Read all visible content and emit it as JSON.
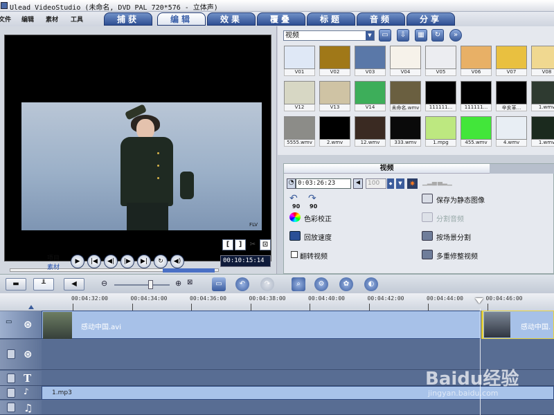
{
  "window": {
    "title": "Ulead VideoStudio (未命名, DVD PAL 720*576 - 立体声)"
  },
  "menu": {
    "items": [
      "文件",
      "编辑",
      "素材",
      "工具"
    ]
  },
  "tabs": [
    {
      "label": "捕获",
      "active": false
    },
    {
      "label": "编辑",
      "active": true
    },
    {
      "label": "效果",
      "active": false
    },
    {
      "label": "覆叠",
      "active": false
    },
    {
      "label": "标题",
      "active": false
    },
    {
      "label": "音频",
      "active": false
    },
    {
      "label": "分享",
      "active": false
    }
  ],
  "preview": {
    "project_label": "项目",
    "clip_label": "素材",
    "timecode": "00:10:15:14",
    "watermark": "FLV"
  },
  "library": {
    "dropdown_value": "视频",
    "items": [
      {
        "label": "V01",
        "color": "#dfe8f6"
      },
      {
        "label": "V02",
        "color": "#a07818"
      },
      {
        "label": "V03",
        "color": "#5a78a8"
      },
      {
        "label": "V04",
        "color": "#f6f2ea"
      },
      {
        "label": "V05",
        "color": "#ecedf1"
      },
      {
        "label": "V06",
        "color": "#e8b066"
      },
      {
        "label": "V07",
        "color": "#e9c040"
      },
      {
        "label": "V08",
        "color": "#f0d890"
      },
      {
        "label": "V12",
        "color": "#d7d7c4"
      },
      {
        "label": "V13",
        "color": "#cfc3a4"
      },
      {
        "label": "V14",
        "color": "#3dae5a"
      },
      {
        "label": "未命名.wmv",
        "color": "#6a5f40"
      },
      {
        "label": "111111...",
        "color": "#000000"
      },
      {
        "label": "111111...",
        "color": "#000000"
      },
      {
        "label": "辛亥革...",
        "color": "#000000"
      },
      {
        "label": "1.wmv",
        "color": "#2e3a30"
      },
      {
        "label": "5555.wmv",
        "color": "#8c8c88"
      },
      {
        "label": "2.wmv",
        "color": "#000000"
      },
      {
        "label": "12.wmv",
        "color": "#3a2a22"
      },
      {
        "label": "333.wmv",
        "color": "#0a0a0a"
      },
      {
        "label": "1.mpg",
        "color": "#bde880"
      },
      {
        "label": "455.wmv",
        "color": "#42e63a"
      },
      {
        "label": "4.wmv",
        "color": "#e8eef4"
      },
      {
        "label": "1.wmv",
        "color": "#1b2a1e"
      }
    ]
  },
  "options": {
    "tab_label": "视频",
    "duration": "0:03:26:23",
    "volume": "100",
    "rotate_left": "90",
    "rotate_right": "90",
    "color_correction": "色彩校正",
    "playback_speed": "回放速度",
    "reverse_video": "翻转视频",
    "save_still": "保存为静态图像",
    "split_audio": "分割音频",
    "split_by_scene": "按场景分割",
    "multi_trim": "多重修整视频"
  },
  "timeline": {
    "ruler_times": [
      "00:04:32:00",
      "00:04:34:00",
      "00:04:36:00",
      "00:04:38:00",
      "00:04:40:00",
      "00:04:42:00",
      "00:04:44:00",
      "00:04:46:00"
    ],
    "video_clip_name": "感动中国.avi",
    "video_clip2_name": "感动中国.",
    "audio_clip_name": "1.mp3"
  },
  "watermark": {
    "brand": "Baidu经验",
    "url": "jingyan.baidu.com"
  }
}
